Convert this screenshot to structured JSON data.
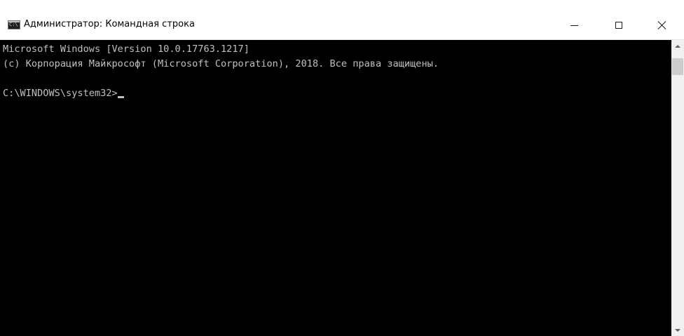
{
  "window": {
    "title": "Администратор: Командная строка",
    "icon": "cmd-icon",
    "icon_text": "C:\\",
    "controls": {
      "minimize": "minimize-icon",
      "maximize": "maximize-icon",
      "close": "close-icon"
    }
  },
  "console": {
    "lines": [
      "Microsoft Windows [Version 10.0.17763.1217]",
      "(c) Корпорация Майкрософт (Microsoft Corporation), 2018. Все права защищены.",
      "",
      "C:\\WINDOWS\\system32>"
    ],
    "text_color": "#C0C0C0",
    "background": "#000000"
  },
  "scrollbar": {
    "position_fraction": 0.0
  }
}
